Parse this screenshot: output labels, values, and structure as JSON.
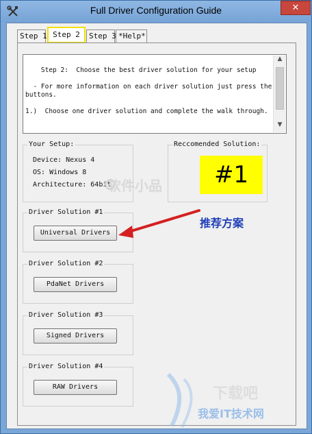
{
  "window": {
    "title": "Full Driver Configuration Guide",
    "close_glyph": "✕"
  },
  "tabs": [
    {
      "label": "Step 1",
      "active": false
    },
    {
      "label": "Step 2",
      "active": true
    },
    {
      "label": "Step 3",
      "active": false
    },
    {
      "label": "*Help*",
      "active": false
    }
  ],
  "instructions": {
    "text": "Step 2:  Choose the best driver solution for your setup\n\n  - For more information on each driver solution just press the buttons.\n\n1.)  Choose one driver solution and complete the walk through."
  },
  "your_setup": {
    "label": "Your Setup:",
    "device": "Device: Nexus 4",
    "os": "OS: Windows 8",
    "architecture": "Architecture: 64bit"
  },
  "recommended": {
    "label": "Reccomended Solution:",
    "value": "#1",
    "highlight_color": "#ffff00"
  },
  "solutions": [
    {
      "group_label": "Driver Solution #1",
      "button_label": "Universal Drivers"
    },
    {
      "group_label": "Driver Solution #2",
      "button_label": "PdaNet Drivers"
    },
    {
      "group_label": "Driver Solution #3",
      "button_label": "Signed Drivers"
    },
    {
      "group_label": "Driver Solution #4",
      "button_label": "RAW Drivers"
    }
  ],
  "annotation": {
    "text": "推荐方案",
    "color": "#1f3fb8",
    "arrow_color": "#d42020"
  },
  "watermarks": {
    "brand": "软件小品",
    "bottom": "我爱IT技术网"
  },
  "icons": {
    "app": "tools-icon",
    "close": "close-icon"
  }
}
